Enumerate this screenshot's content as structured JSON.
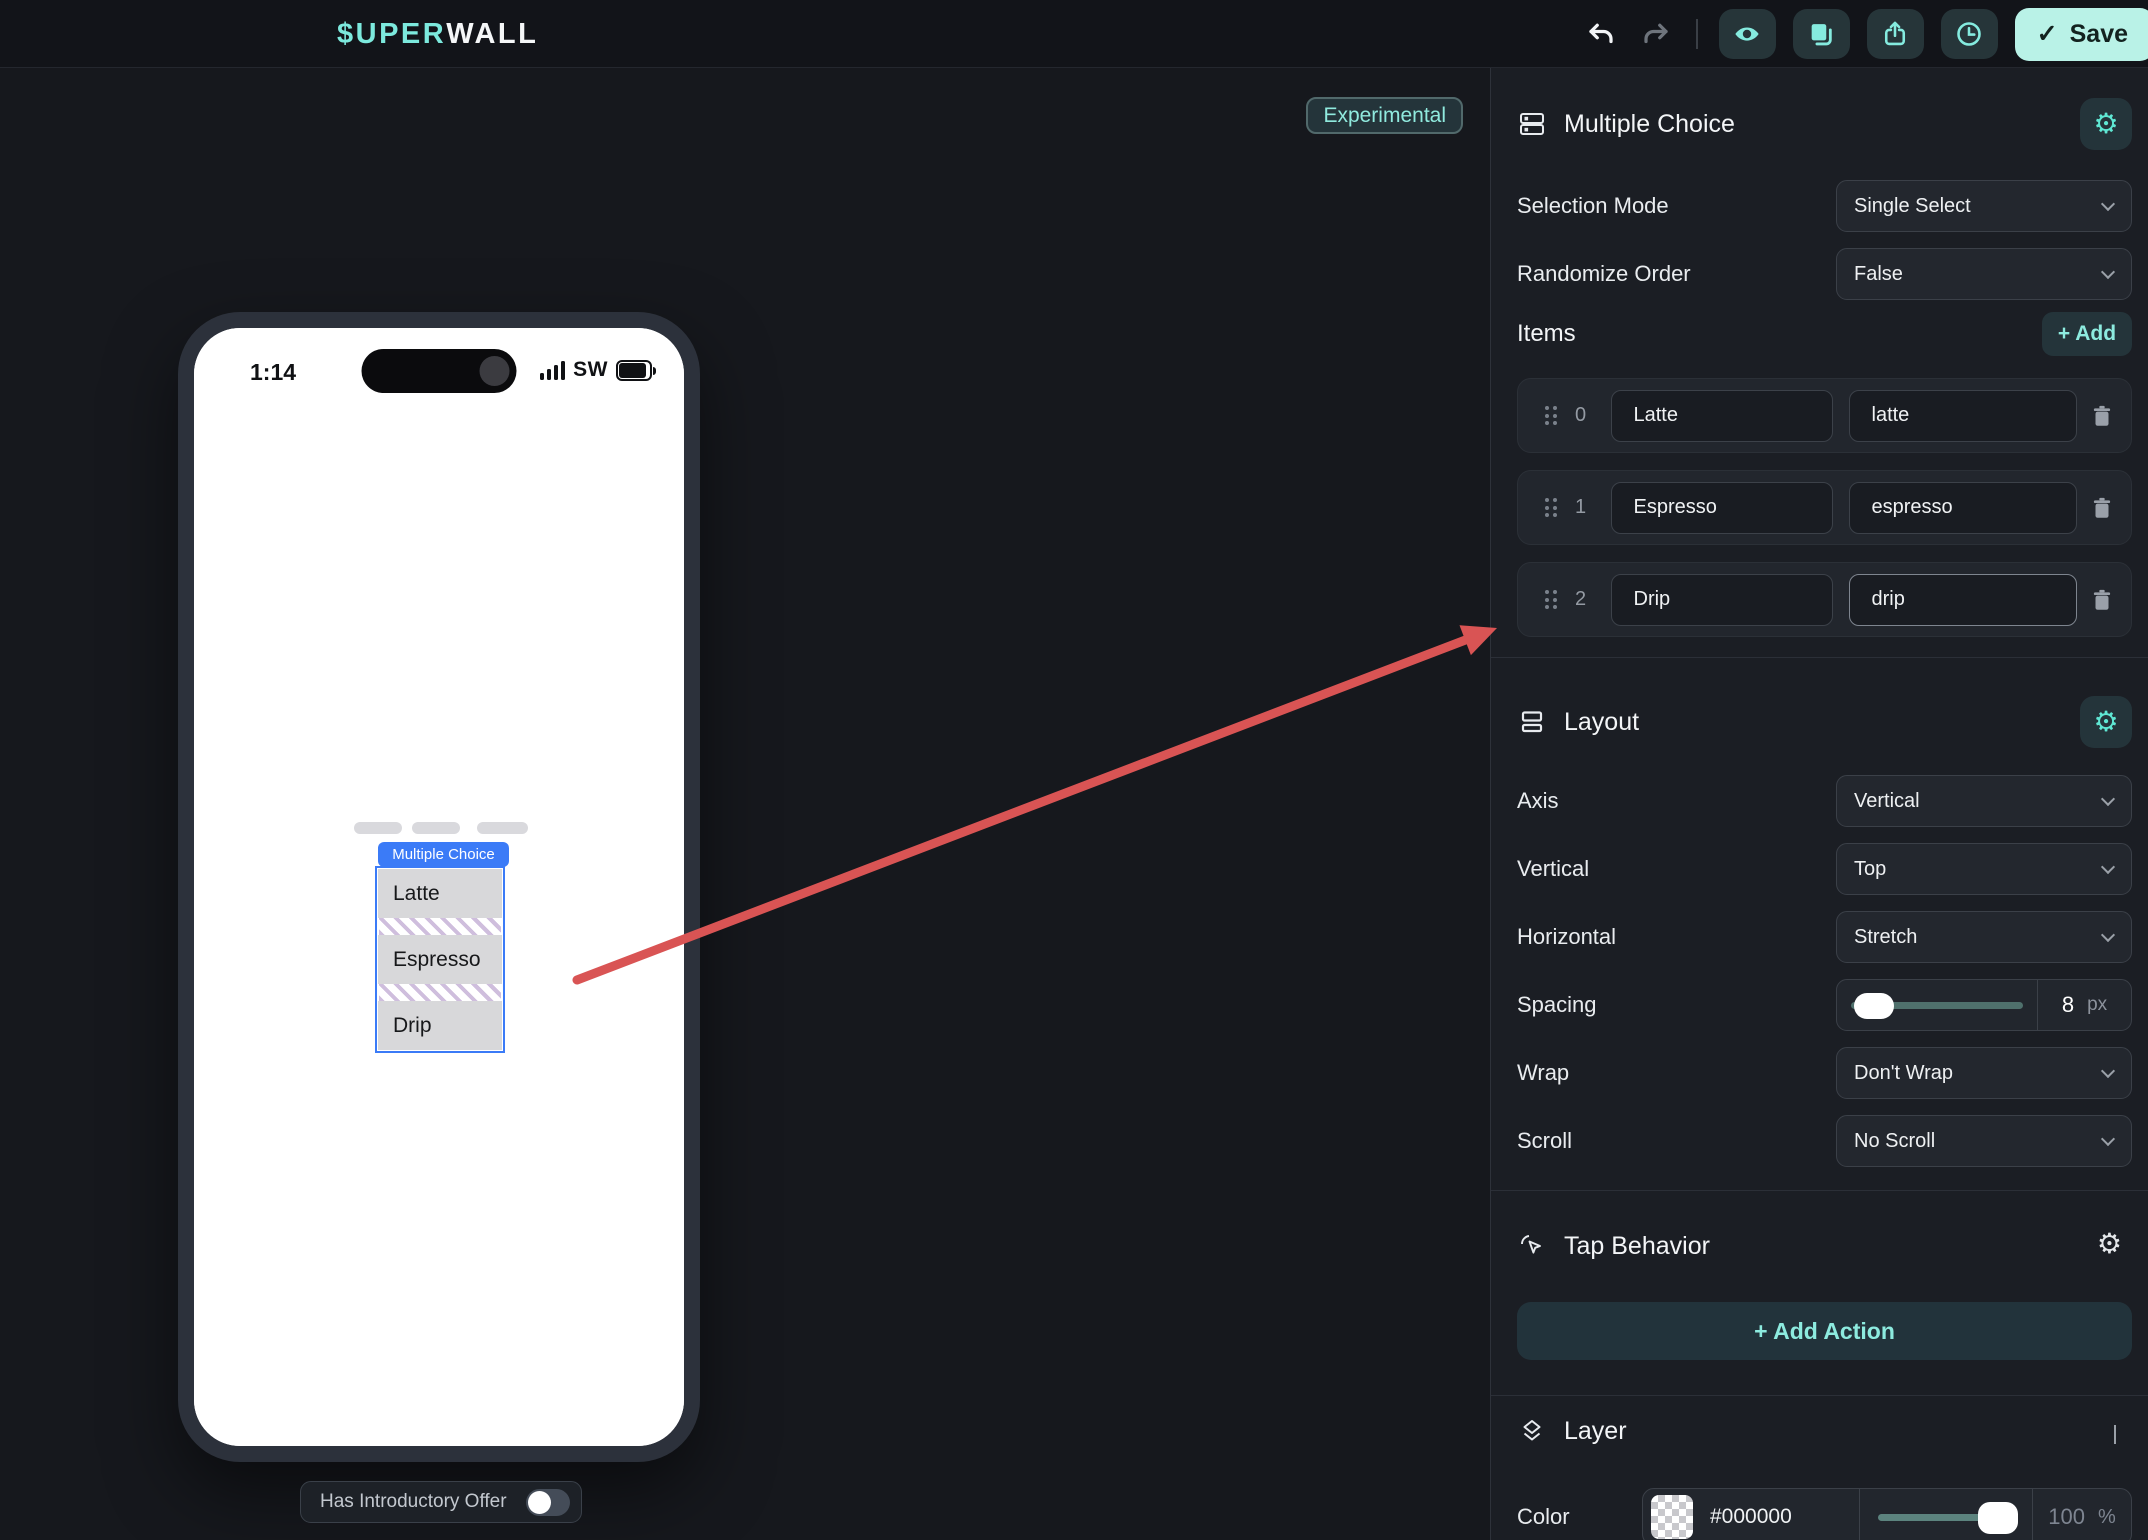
{
  "topbar": {
    "logo_teal": "$UPER",
    "logo_white": "WALL",
    "save": {
      "icon": "✓",
      "label": "Save"
    }
  },
  "canvas": {
    "experimental_badge": "Experimental",
    "phone": {
      "status": {
        "time": "1:14",
        "carrier": "SW"
      },
      "widget": {
        "tag": "Multiple Choice",
        "options": [
          "Latte",
          "Espresso",
          "Drip"
        ]
      },
      "offer_toggle_label": "Has Introductory Offer"
    }
  },
  "panel": {
    "multiple_choice": {
      "title": "Multiple Choice",
      "selection_mode": {
        "label": "Selection Mode",
        "value": "Single Select"
      },
      "randomize": {
        "label": "Randomize Order",
        "value": "False"
      },
      "items_label": "Items",
      "add_label": "+ Add",
      "items": [
        {
          "index": "0",
          "label": "Latte",
          "value": "latte"
        },
        {
          "index": "1",
          "label": "Espresso",
          "value": "espresso"
        },
        {
          "index": "2",
          "label": "Drip",
          "value": "drip"
        }
      ]
    },
    "layout": {
      "title": "Layout",
      "axis": {
        "label": "Axis",
        "value": "Vertical"
      },
      "vertical": {
        "label": "Vertical",
        "value": "Top"
      },
      "horizontal": {
        "label": "Horizontal",
        "value": "Stretch"
      },
      "spacing": {
        "label": "Spacing",
        "value": "8",
        "unit": "px"
      },
      "wrap": {
        "label": "Wrap",
        "value": "Don't Wrap"
      },
      "scroll": {
        "label": "Scroll",
        "value": "No Scroll"
      }
    },
    "tap_behavior": {
      "title": "Tap Behavior",
      "add_action_label": "+ Add Action"
    },
    "layer": {
      "title": "Layer",
      "color": {
        "label": "Color",
        "hex": "#000000",
        "opacity": "100",
        "unit": "%"
      }
    }
  },
  "colors": {
    "accent_teal": "#8debdf",
    "save_bg": "#b9f2e7",
    "widget_blue": "#3b7bf7",
    "arrow_red": "#d95454",
    "layer_color_value": "#000000"
  }
}
